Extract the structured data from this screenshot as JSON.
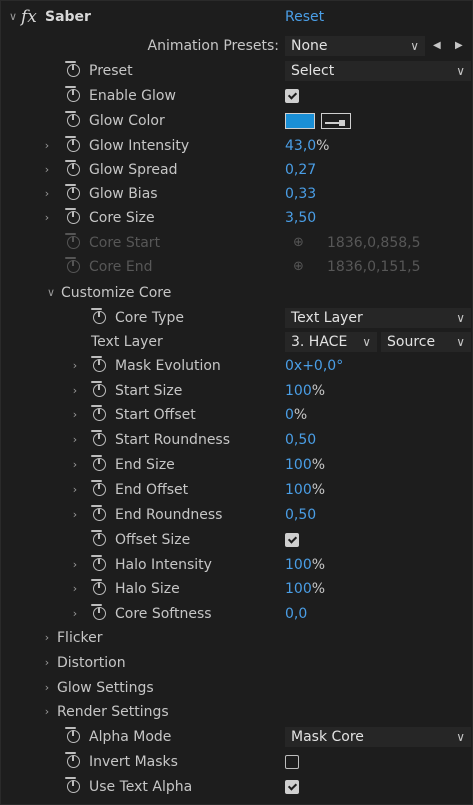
{
  "effect": {
    "fx_symbol": "fx",
    "name": "Saber",
    "reset_label": "Reset",
    "animation_presets_label": "Animation Presets:",
    "animation_presets_value": "None"
  },
  "props": {
    "preset": {
      "label": "Preset",
      "value": "Select"
    },
    "enable_glow": {
      "label": "Enable Glow",
      "checked": true
    },
    "glow_color": {
      "label": "Glow Color",
      "color": "#1a8fd6"
    },
    "glow_intensity": {
      "label": "Glow Intensity",
      "value": "43,0",
      "unit": "%"
    },
    "glow_spread": {
      "label": "Glow Spread",
      "value": "0,27"
    },
    "glow_bias": {
      "label": "Glow Bias",
      "value": "0,33"
    },
    "core_size": {
      "label": "Core Size",
      "value": "3,50"
    },
    "core_start": {
      "label": "Core Start",
      "value": "1836,0,858,5"
    },
    "core_end": {
      "label": "Core End",
      "value": "1836,0,151,5"
    }
  },
  "customize_core": {
    "label": "Customize Core",
    "core_type": {
      "label": "Core Type",
      "value": "Text Layer"
    },
    "text_layer": {
      "label": "Text Layer",
      "value": "3. HACE",
      "source": "Source"
    },
    "mask_evolution": {
      "label": "Mask Evolution",
      "value": "0x+0,0°"
    },
    "start_size": {
      "label": "Start Size",
      "value": "100",
      "unit": "%"
    },
    "start_offset": {
      "label": "Start Offset",
      "value": "0",
      "unit": "%"
    },
    "start_roundness": {
      "label": "Start Roundness",
      "value": "0,50"
    },
    "end_size": {
      "label": "End Size",
      "value": "100",
      "unit": "%"
    },
    "end_offset": {
      "label": "End Offset",
      "value": "100",
      "unit": "%"
    },
    "end_roundness": {
      "label": "End Roundness",
      "value": "0,50"
    },
    "offset_size": {
      "label": "Offset Size",
      "checked": true
    },
    "halo_intensity": {
      "label": "Halo Intensity",
      "value": "100",
      "unit": "%"
    },
    "halo_size": {
      "label": "Halo Size",
      "value": "100",
      "unit": "%"
    },
    "core_softness": {
      "label": "Core Softness",
      "value": "0,0"
    }
  },
  "groups": {
    "flicker": "Flicker",
    "distortion": "Distortion",
    "glow_settings": "Glow Settings",
    "render_settings": "Render Settings"
  },
  "bottom": {
    "alpha_mode": {
      "label": "Alpha Mode",
      "value": "Mask Core"
    },
    "invert_masks": {
      "label": "Invert Masks",
      "checked": false
    },
    "use_text_alpha": {
      "label": "Use Text Alpha",
      "checked": true
    }
  }
}
